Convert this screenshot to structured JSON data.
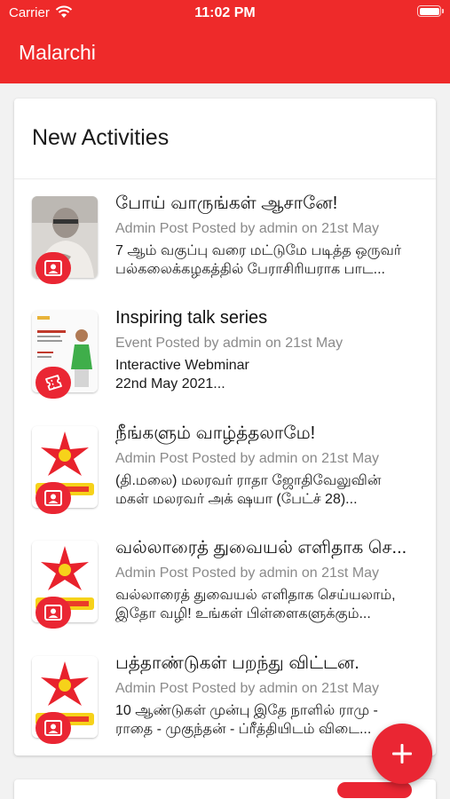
{
  "status_bar": {
    "carrier": "Carrier",
    "time": "11:02 PM"
  },
  "app_bar": {
    "title": "Malarchi"
  },
  "colors": {
    "primary": "#ee2a2a",
    "accent": "#ea2633"
  },
  "activities": {
    "heading": "New Activities",
    "items": [
      {
        "title": "போய் வாருங்கள் ஆசானே!",
        "meta": "Admin Post Posted by admin on 21st May",
        "description": "7 ஆம் வகுப்பு வரை மட்டுமே படித்த ஒருவர்\nபல்கலைக்கழகத்தில் பேராசிரியராக பாட...",
        "thumb": "portrait-photo",
        "badge_icon": "contact-card-icon"
      },
      {
        "title": "Inspiring talk series",
        "meta": "Event Posted by admin on 21st May",
        "description": "Interactive Webminar\n22nd May 2021...",
        "thumb": "event-poster",
        "badge_icon": "ticket-icon"
      },
      {
        "title": "நீங்களும் வாழ்த்தலாமே!",
        "meta": "Admin Post Posted by admin on 21st May",
        "description": "(தி.மலை) மலரவர் ராதா ஜோதிவேலுவின்\nமகள் மலரவர் அக் ஷயா (பேட்ச் 28)...",
        "thumb": "flower-logo",
        "badge_icon": "contact-card-icon"
      },
      {
        "title": "வல்லாரைத் துவையல் எளிதாக செ...",
        "meta": "Admin Post Posted by admin on 21st May",
        "description": "வல்லாரைத் துவையல் எளிதாக செய்யலாம்,\nஇதோ வழி! உங்கள் பிள்ளைகளுக்கும்...",
        "thumb": "flower-logo",
        "badge_icon": "contact-card-icon"
      },
      {
        "title": "பத்தாண்டுகள் பறந்து விட்டன.",
        "meta": "Admin Post Posted by admin on 21st May",
        "description": "10 ஆண்டுகள் முன்பு இதே நாளில் ராமு -\nராதை - முகுந்தன் - ப்ரீத்தியிடம் விடை...",
        "thumb": "flower-logo",
        "badge_icon": "contact-card-icon"
      }
    ]
  },
  "fab": {
    "icon": "plus-icon"
  }
}
